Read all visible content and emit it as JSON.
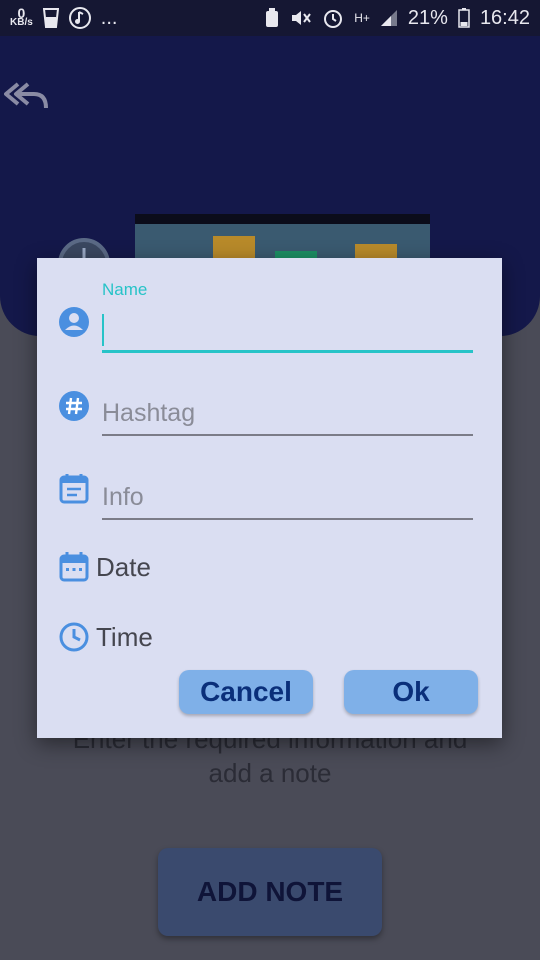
{
  "status_bar": {
    "speed_value": "0",
    "speed_unit": "KB/s",
    "more": "...",
    "network": "H+",
    "battery": "21%",
    "time": "16:42"
  },
  "background": {
    "helper_text_line1": "Enter the required information and",
    "helper_text_line2": "add a note",
    "add_note_label": "ADD NOTE"
  },
  "dialog": {
    "name_label": "Name",
    "name_value": "",
    "hashtag_placeholder": "Hashtag",
    "info_placeholder": "Info",
    "date_label": "Date",
    "time_label": "Time",
    "cancel_label": "Cancel",
    "ok_label": "Ok"
  },
  "colors": {
    "accent": "#27c3c8",
    "icon_blue": "#4a8fe0",
    "header_bg": "#14184a",
    "dialog_bg": "#dadef2",
    "button_bg": "#7fb0e8",
    "button_text": "#0a2f7a"
  }
}
